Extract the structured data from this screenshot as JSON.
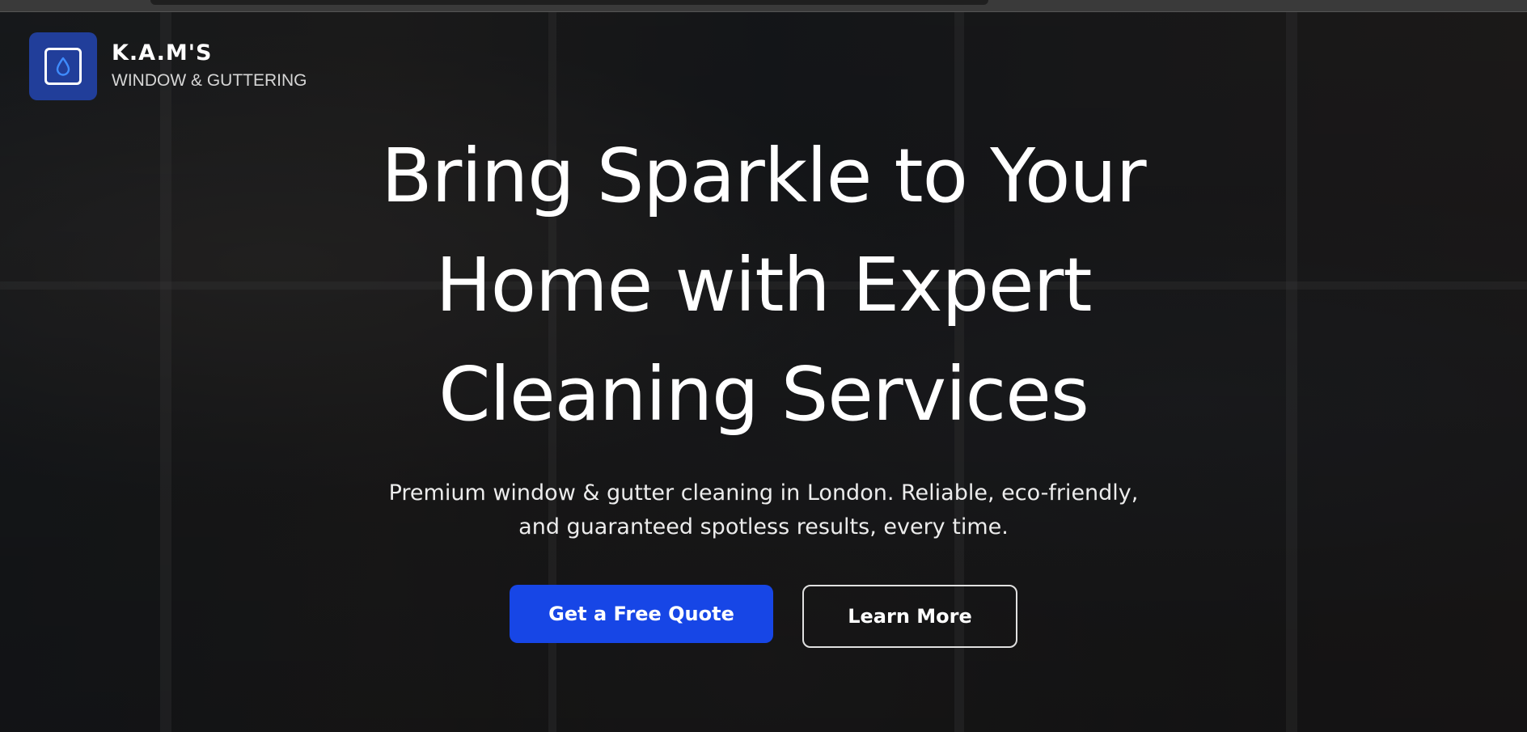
{
  "brand": {
    "name": "K.A.M'S",
    "tagline": "WINDOW & GUTTERING",
    "logo_icon": "water-drop-icon",
    "logo_color": "#213e9a"
  },
  "hero": {
    "title": "Bring Sparkle to Your Home with Expert Cleaning Services",
    "subtitle": "Premium window & gutter cleaning in London. Reliable, eco-friendly, and guaranteed spotless results, every time.",
    "primary_cta": "Get a Free Quote",
    "secondary_cta": "Learn More",
    "primary_color": "#1746e6"
  }
}
